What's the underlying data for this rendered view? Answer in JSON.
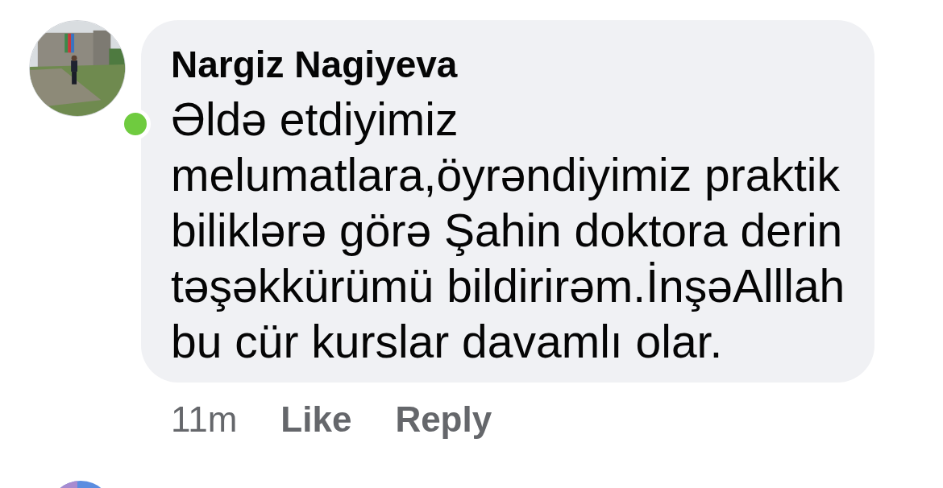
{
  "comment": {
    "author": "Nargiz Nagiyeva",
    "online": true,
    "text": "Əldə etdiyimiz melumatlara,öyrəndiyimiz praktik biliklərə görə Şahin doktora derin təşəkkürümü bildirirəm.İnşəAlllah bu cür kurslar davamlı olar.",
    "time": "11m",
    "actions": [
      "Like",
      "Reply"
    ]
  }
}
